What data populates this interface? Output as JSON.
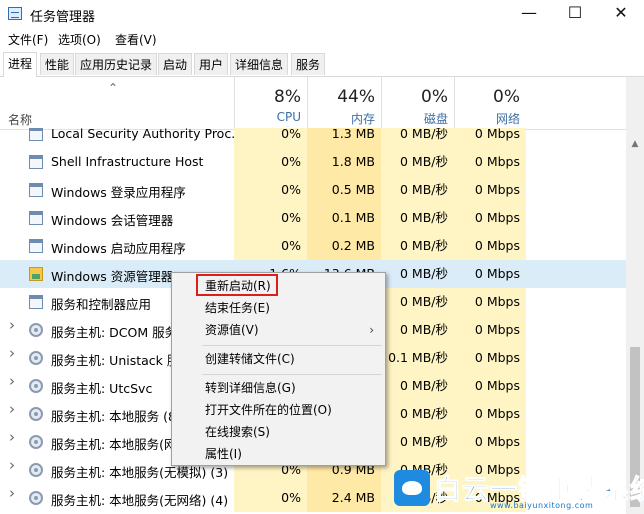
{
  "window": {
    "title": "任务管理器",
    "minimize_icon": "minimize-icon",
    "maximize_icon": "maximize-icon",
    "close_icon": "close-icon"
  },
  "menu": [
    "文件(F)",
    "选项(O)",
    "查看(V)"
  ],
  "tabs": [
    "进程",
    "性能",
    "应用历史记录",
    "启动",
    "用户",
    "详细信息",
    "服务"
  ],
  "active_tab": "进程",
  "header": {
    "name": "名称",
    "columns": [
      {
        "pct": "8%",
        "label": "CPU"
      },
      {
        "pct": "44%",
        "label": "内存"
      },
      {
        "pct": "0%",
        "label": "磁盘"
      },
      {
        "pct": "0%",
        "label": "网络"
      }
    ]
  },
  "rows": [
    {
      "name": "Local Security Authority Proc...",
      "cpu": "0%",
      "mem": "1.3 MB",
      "disk": "0 MB/秒",
      "net": "0 Mbps",
      "icon": "window-icon",
      "expand": false
    },
    {
      "name": "Shell Infrastructure Host",
      "cpu": "0%",
      "mem": "1.8 MB",
      "disk": "0 MB/秒",
      "net": "0 Mbps",
      "icon": "window-icon",
      "expand": false
    },
    {
      "name": "Windows 登录应用程序",
      "cpu": "0%",
      "mem": "0.5 MB",
      "disk": "0 MB/秒",
      "net": "0 Mbps",
      "icon": "window-icon",
      "expand": false
    },
    {
      "name": "Windows 会话管理器",
      "cpu": "0%",
      "mem": "0.1 MB",
      "disk": "0 MB/秒",
      "net": "0 Mbps",
      "icon": "window-icon",
      "expand": false
    },
    {
      "name": "Windows 启动应用程序",
      "cpu": "0%",
      "mem": "0.2 MB",
      "disk": "0 MB/秒",
      "net": "0 Mbps",
      "icon": "window-icon",
      "expand": false
    },
    {
      "name": "Windows 资源管理器",
      "cpu": "1.6%",
      "mem": "13.6 MB",
      "disk": "0 MB/秒",
      "net": "0 Mbps",
      "icon": "explorer-icon",
      "expand": false,
      "selected": true
    },
    {
      "name": "服务和控制器应用",
      "cpu": "",
      "mem": "",
      "disk": "0 MB/秒",
      "net": "0 Mbps",
      "icon": "window-icon",
      "expand": false
    },
    {
      "name": "服务主机: DCOM 服务",
      "cpu": "",
      "mem": "",
      "disk": "0 MB/秒",
      "net": "0 Mbps",
      "icon": "gear-icon",
      "expand": true
    },
    {
      "name": "服务主机: Unistack 服",
      "cpu": "",
      "mem": "",
      "disk": "0.1 MB/秒",
      "net": "0 Mbps",
      "icon": "gear-icon",
      "expand": true
    },
    {
      "name": "服务主机: UtcSvc",
      "cpu": "",
      "mem": "",
      "disk": "0 MB/秒",
      "net": "0 Mbps",
      "icon": "gear-icon",
      "expand": true
    },
    {
      "name": "服务主机: 本地服务 (8",
      "cpu": "",
      "mem": "",
      "disk": "0 MB/秒",
      "net": "0 Mbps",
      "icon": "gear-icon",
      "expand": true
    },
    {
      "name": "服务主机: 本地服务(网",
      "cpu": "",
      "mem": "",
      "disk": "0 MB/秒",
      "net": "0 Mbps",
      "icon": "gear-icon",
      "expand": true
    },
    {
      "name": "服务主机: 本地服务(无模拟) (3)",
      "cpu": "0%",
      "mem": "0.9 MB",
      "disk": "0 MB/秒",
      "net": "0 Mbps",
      "icon": "gear-icon",
      "expand": true
    },
    {
      "name": "服务主机: 本地服务(无网络) (4)",
      "cpu": "0%",
      "mem": "2.4 MB",
      "disk": "0 MB/秒",
      "net": "0 Mbps",
      "icon": "gear-icon",
      "expand": true
    }
  ],
  "context_menu": {
    "items": [
      {
        "label": "重新启动(R)"
      },
      {
        "label": "结束任务(E)"
      },
      {
        "label": "资源值(V)",
        "submenu": "›"
      },
      {
        "label": "创建转储文件(C)"
      },
      {
        "label": "转到详细信息(G)"
      },
      {
        "label": "打开文件所在的位置(O)"
      },
      {
        "label": "在线搜索(S)"
      },
      {
        "label": "属性(I)"
      }
    ]
  },
  "watermark": {
    "text": "白云一键重装系统",
    "url": "www.baiyunxitong.com"
  }
}
